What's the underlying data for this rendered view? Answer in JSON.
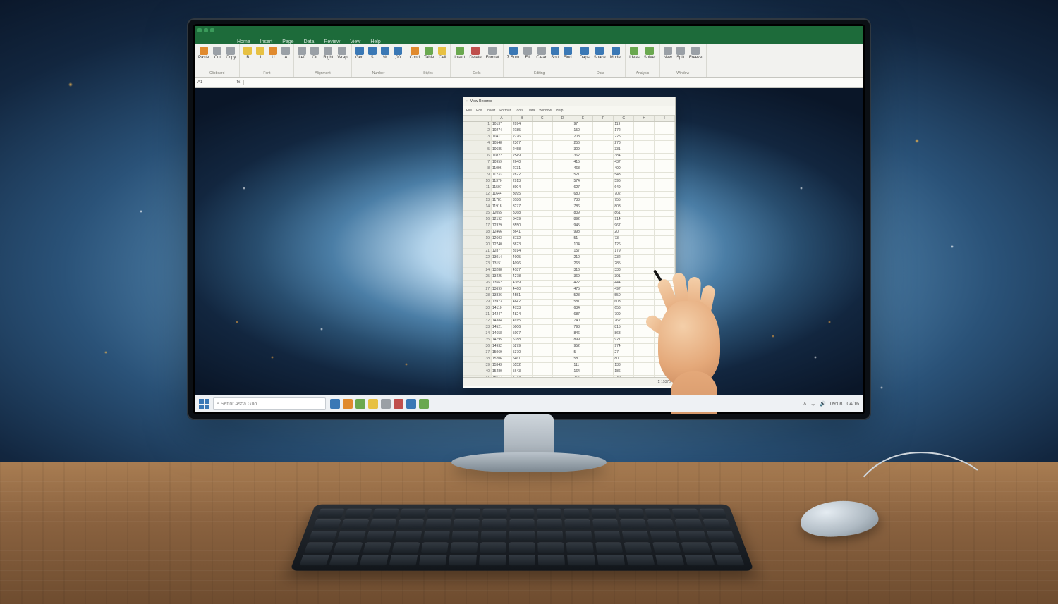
{
  "app": {
    "tabs": [
      "Home",
      "Insert",
      "Page",
      "Data",
      "Review",
      "View",
      "Help"
    ],
    "namebox": "A1",
    "fx": "fx",
    "formula": ""
  },
  "ribbon": {
    "groups": [
      {
        "label": "Clipboard",
        "buttons": [
          {
            "icon": "c-or",
            "text": "Paste"
          },
          {
            "icon": "c-gy",
            "text": "Cut"
          },
          {
            "icon": "c-gy",
            "text": "Copy"
          }
        ]
      },
      {
        "label": "Font",
        "buttons": [
          {
            "icon": "c-yl",
            "text": "B"
          },
          {
            "icon": "c-yl",
            "text": "I"
          },
          {
            "icon": "c-or",
            "text": "U"
          },
          {
            "icon": "c-gy",
            "text": "A"
          }
        ]
      },
      {
        "label": "Alignment",
        "buttons": [
          {
            "icon": "c-gy",
            "text": "Left"
          },
          {
            "icon": "c-gy",
            "text": "Ctr"
          },
          {
            "icon": "c-gy",
            "text": "Right"
          },
          {
            "icon": "c-gy",
            "text": "Wrap"
          }
        ]
      },
      {
        "label": "Number",
        "buttons": [
          {
            "icon": "c-bl",
            "text": "Gen"
          },
          {
            "icon": "c-bl",
            "text": "$"
          },
          {
            "icon": "c-bl",
            "text": "%"
          },
          {
            "icon": "c-bl",
            "text": ",00"
          }
        ]
      },
      {
        "label": "Styles",
        "buttons": [
          {
            "icon": "c-or",
            "text": "Cond"
          },
          {
            "icon": "c-gr",
            "text": "Table"
          },
          {
            "icon": "c-yl",
            "text": "Cell"
          }
        ]
      },
      {
        "label": "Cells",
        "buttons": [
          {
            "icon": "c-gr",
            "text": "Insert"
          },
          {
            "icon": "c-rd",
            "text": "Delete"
          },
          {
            "icon": "c-gy",
            "text": "Format"
          }
        ]
      },
      {
        "label": "Editing",
        "buttons": [
          {
            "icon": "c-bl",
            "text": "Σ Sum"
          },
          {
            "icon": "c-gy",
            "text": "Fill"
          },
          {
            "icon": "c-gy",
            "text": "Clear"
          },
          {
            "icon": "c-bl",
            "text": "Sort"
          },
          {
            "icon": "c-bl",
            "text": "Find"
          }
        ]
      },
      {
        "label": "Data",
        "buttons": [
          {
            "icon": "c-bl",
            "text": "Daps"
          },
          {
            "icon": "c-bl",
            "text": "Space"
          },
          {
            "icon": "c-bl",
            "text": "Model"
          }
        ]
      },
      {
        "label": "Analysis",
        "buttons": [
          {
            "icon": "c-gr",
            "text": "Ideas"
          },
          {
            "icon": "c-gr",
            "text": "Solver"
          }
        ]
      },
      {
        "label": "Window",
        "buttons": [
          {
            "icon": "c-gy",
            "text": "New"
          },
          {
            "icon": "c-gy",
            "text": "Split"
          },
          {
            "icon": "c-gy",
            "text": "Freeze"
          }
        ]
      }
    ]
  },
  "sheetwin": {
    "title": "View Records",
    "toolbar": [
      "File",
      "Edit",
      "Insert",
      "Format",
      "Tools",
      "Data",
      "Window",
      "Help"
    ],
    "columns": [
      "",
      "A",
      "B",
      "C",
      "D",
      "E",
      "F",
      "G",
      "H",
      "I"
    ],
    "status": "Σ 15370",
    "rowCount": 45
  },
  "taskbar": {
    "search": "Settor Asda Guo..",
    "icons": [
      "c-bl",
      "c-or",
      "c-gr",
      "c-yl",
      "c-gy",
      "c-rd",
      "c-bl",
      "c-gr"
    ],
    "time": "09:08",
    "date": "04/16"
  }
}
